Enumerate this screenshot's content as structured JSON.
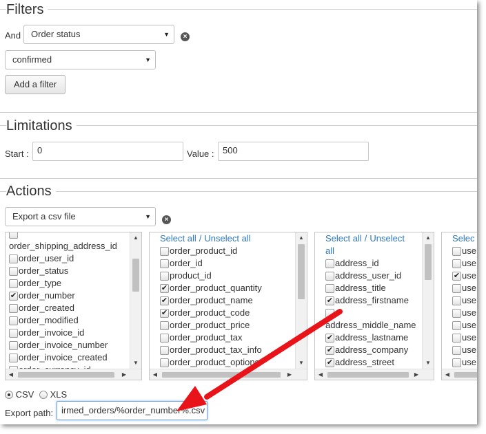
{
  "filters": {
    "legend": "Filters",
    "and_label": "And",
    "field_select": "Order status",
    "value_select": "confirmed",
    "add_filter_label": "Add a filter"
  },
  "limitations": {
    "legend": "Limitations",
    "start_label": "Start :",
    "start_value": "0",
    "value_label": "Value :",
    "value_value": "500"
  },
  "actions": {
    "legend": "Actions",
    "action_select": "Export a csv file"
  },
  "select_links": {
    "select_all": "Select all",
    "separator": "/",
    "unselect_all": "Unselect all",
    "unselect_all_wrap1": "Unselect",
    "unselect_all_wrap2": "all",
    "truncated": "Selec"
  },
  "list1": [
    {
      "label": "order_shipping_address_id",
      "checkbox": false
    },
    {
      "label": "order_user_id",
      "checkbox": true,
      "checked": false
    },
    {
      "label": "order_status",
      "checkbox": true,
      "checked": false
    },
    {
      "label": "order_type",
      "checkbox": true,
      "checked": false
    },
    {
      "label": "order_number",
      "checkbox": true,
      "checked": true
    },
    {
      "label": "order_created",
      "checkbox": true,
      "checked": false
    },
    {
      "label": "order_modified",
      "checkbox": true,
      "checked": false
    },
    {
      "label": "order_invoice_id",
      "checkbox": true,
      "checked": false
    },
    {
      "label": "order_invoice_number",
      "checkbox": true,
      "checked": false
    },
    {
      "label": "order_invoice_created",
      "checkbox": true,
      "checked": false
    },
    {
      "label": "order_currency_id",
      "checkbox": true,
      "checked": false
    }
  ],
  "list2": [
    {
      "label": "order_product_id",
      "checked": false
    },
    {
      "label": "order_id",
      "checked": false
    },
    {
      "label": "product_id",
      "checked": false
    },
    {
      "label": "order_product_quantity",
      "checked": true
    },
    {
      "label": "order_product_name",
      "checked": true
    },
    {
      "label": "order_product_code",
      "checked": true
    },
    {
      "label": "order_product_price",
      "checked": false
    },
    {
      "label": "order_product_tax",
      "checked": false
    },
    {
      "label": "order_product_tax_info",
      "checked": false
    },
    {
      "label": "order_product_options",
      "checked": false
    }
  ],
  "list3": [
    {
      "label": "address_id",
      "checkbox": true,
      "checked": false
    },
    {
      "label": "address_user_id",
      "checkbox": true,
      "checked": false
    },
    {
      "label": "address_title",
      "checkbox": true,
      "checked": false
    },
    {
      "label": "address_firstname",
      "checkbox": true,
      "checked": true
    },
    {
      "label": "",
      "checkbox": true,
      "checked": false
    },
    {
      "label": "address_middle_name",
      "checkbox": false
    },
    {
      "label": "address_lastname",
      "checkbox": true,
      "checked": true
    },
    {
      "label": "address_company",
      "checkbox": true,
      "checked": true
    },
    {
      "label": "address_street",
      "checkbox": true,
      "checked": true
    }
  ],
  "list4": [
    {
      "label": "use",
      "checked": false
    },
    {
      "label": "use",
      "checked": false
    },
    {
      "label": "use",
      "checked": true
    },
    {
      "label": "use",
      "checked": false
    },
    {
      "label": "use",
      "checked": false
    },
    {
      "label": "use",
      "checked": false
    },
    {
      "label": "use",
      "checked": false
    },
    {
      "label": "use",
      "checked": false
    },
    {
      "label": "use",
      "checked": false
    },
    {
      "label": "use",
      "checked": false
    }
  ],
  "format": {
    "csv_label": "CSV",
    "xls_label": "XLS",
    "selected": "CSV"
  },
  "export": {
    "path_label": "Export path:",
    "path_value": "irmed_orders/%order_number%.csv"
  },
  "colors": {
    "link": "#2e78c0",
    "arrow": "#e8141a",
    "focus_border": "#6ea3d6"
  }
}
